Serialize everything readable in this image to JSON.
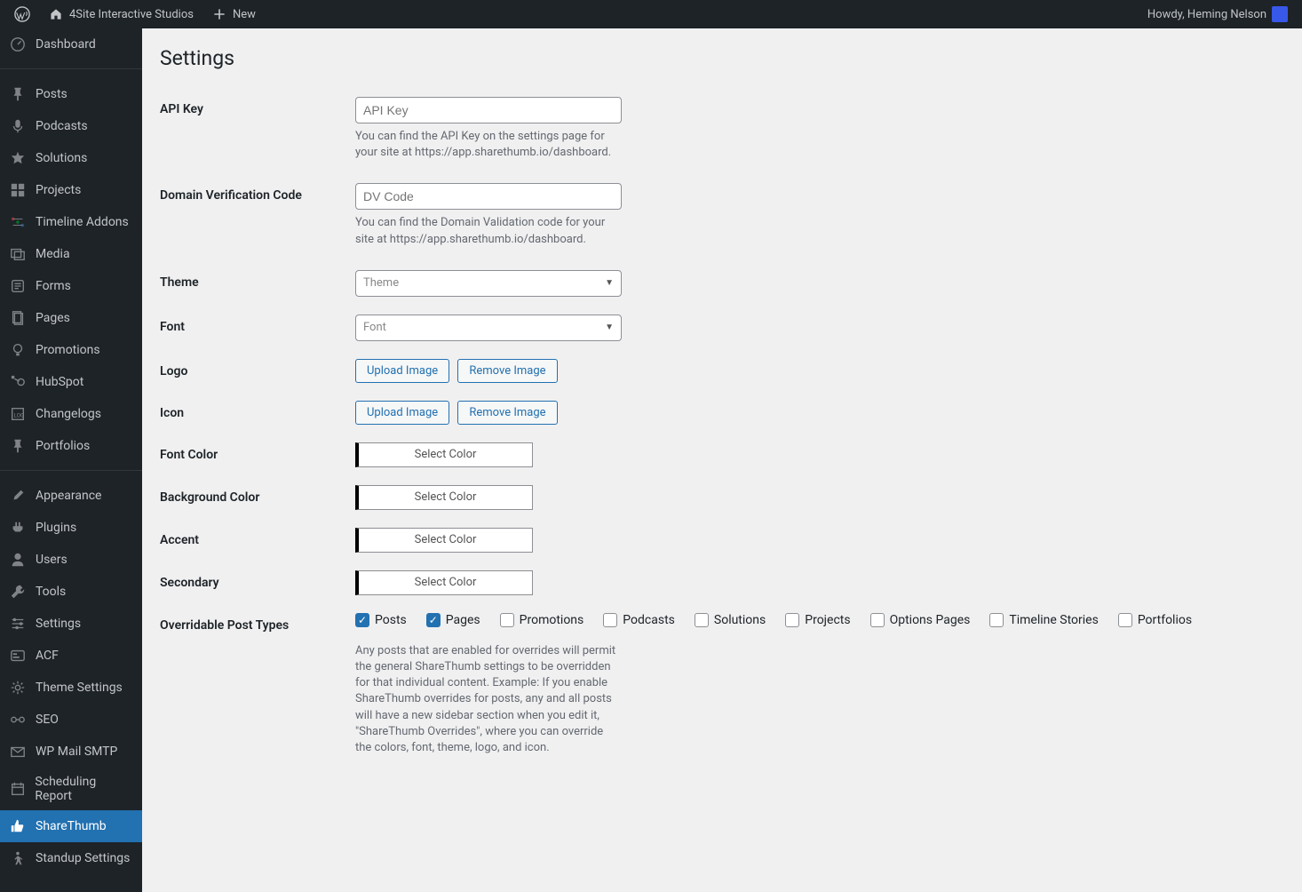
{
  "adminbar": {
    "site_name": "4Site Interactive Studios",
    "new_label": "New",
    "howdy": "Howdy, Heming Nelson"
  },
  "sidebar": {
    "items": [
      {
        "label": "Dashboard",
        "icon": "dashboard"
      },
      {
        "label": "Posts",
        "icon": "pin"
      },
      {
        "label": "Podcasts",
        "icon": "mic"
      },
      {
        "label": "Solutions",
        "icon": "star"
      },
      {
        "label": "Projects",
        "icon": "grid"
      },
      {
        "label": "Timeline Addons",
        "icon": "timeline"
      },
      {
        "label": "Media",
        "icon": "media"
      },
      {
        "label": "Forms",
        "icon": "forms"
      },
      {
        "label": "Pages",
        "icon": "pages"
      },
      {
        "label": "Promotions",
        "icon": "bulb"
      },
      {
        "label": "HubSpot",
        "icon": "hubspot"
      },
      {
        "label": "Changelogs",
        "icon": "log"
      },
      {
        "label": "Portfolios",
        "icon": "pin"
      },
      {
        "label": "Appearance",
        "icon": "brush"
      },
      {
        "label": "Plugins",
        "icon": "plugin"
      },
      {
        "label": "Users",
        "icon": "user"
      },
      {
        "label": "Tools",
        "icon": "wrench"
      },
      {
        "label": "Settings",
        "icon": "sliders"
      },
      {
        "label": "ACF",
        "icon": "acf"
      },
      {
        "label": "Theme Settings",
        "icon": "gear"
      },
      {
        "label": "SEO",
        "icon": "seo"
      },
      {
        "label": "WP Mail SMTP",
        "icon": "mail"
      },
      {
        "label": "Scheduling Report",
        "icon": "calendar"
      },
      {
        "label": "ShareThumb",
        "icon": "thumb",
        "active": true
      },
      {
        "label": "Standup Settings",
        "icon": "person"
      }
    ],
    "separators_after": [
      0,
      12
    ]
  },
  "page": {
    "title": "Settings",
    "fields": {
      "api_key": {
        "label": "API Key",
        "placeholder": "API Key",
        "desc": "You can find the API Key on the settings page for your site at https://app.sharethumb.io/dashboard."
      },
      "dv_code": {
        "label": "Domain Verification Code",
        "placeholder": "DV Code",
        "desc": "You can find the Domain Validation code for your site at https://app.sharethumb.io/dashboard."
      },
      "theme": {
        "label": "Theme",
        "placeholder": "Theme"
      },
      "font": {
        "label": "Font",
        "placeholder": "Font"
      },
      "logo": {
        "label": "Logo",
        "upload": "Upload Image",
        "remove": "Remove Image"
      },
      "icon": {
        "label": "Icon",
        "upload": "Upload Image",
        "remove": "Remove Image"
      },
      "font_color": {
        "label": "Font Color",
        "btn": "Select Color"
      },
      "bg_color": {
        "label": "Background Color",
        "btn": "Select Color"
      },
      "accent": {
        "label": "Accent",
        "btn": "Select Color"
      },
      "secondary": {
        "label": "Secondary",
        "btn": "Select Color"
      },
      "post_types": {
        "label": "Overridable Post Types",
        "options": [
          {
            "label": "Posts",
            "checked": true
          },
          {
            "label": "Pages",
            "checked": true
          },
          {
            "label": "Promotions",
            "checked": false
          },
          {
            "label": "Podcasts",
            "checked": false
          },
          {
            "label": "Solutions",
            "checked": false
          },
          {
            "label": "Projects",
            "checked": false
          },
          {
            "label": "Options Pages",
            "checked": false
          },
          {
            "label": "Timeline Stories",
            "checked": false
          },
          {
            "label": "Portfolios",
            "checked": false
          }
        ],
        "desc": "Any posts that are enabled for overrides will permit the general ShareThumb settings to be overridden for that individual content. Example: If you enable ShareThumb overrides for posts, any and all posts will have a new sidebar section when you edit it, \"ShareThumb Overrides\", where you can override the colors, font, theme, logo, and icon."
      }
    }
  }
}
